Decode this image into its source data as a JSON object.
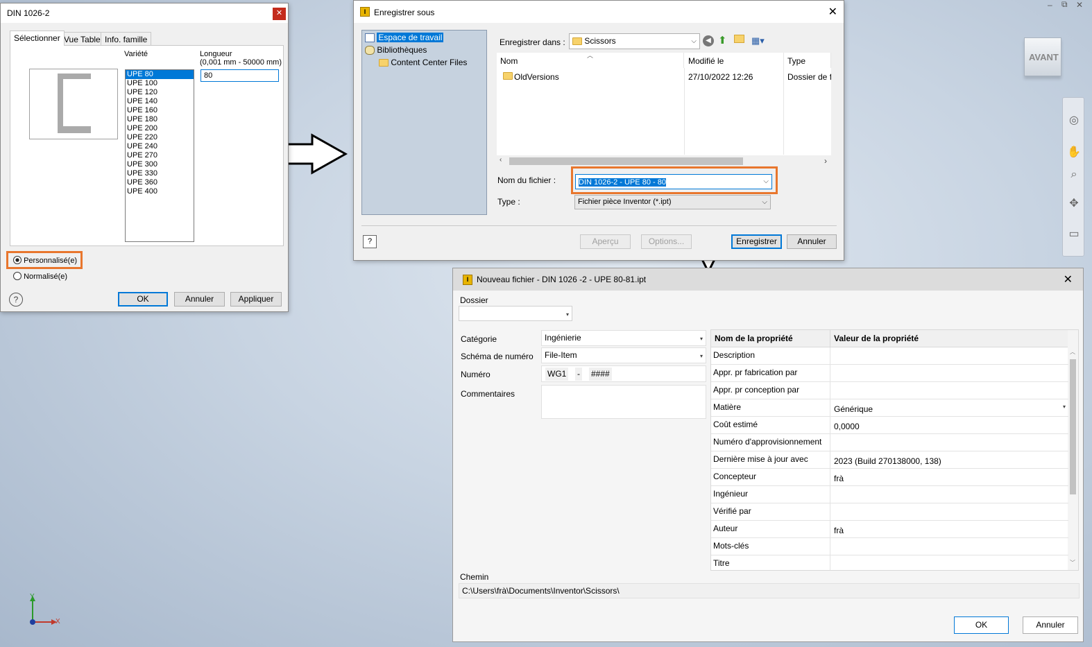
{
  "window_controls": {
    "restore": "⧉",
    "minimize": "–",
    "close": "✕"
  },
  "viewcube": {
    "label": "AVANT"
  },
  "axis": {
    "x": "X",
    "y": "Y"
  },
  "dialog1": {
    "title": "DIN 1026-2",
    "tabs": [
      "Sélectionner",
      "Vue Table",
      "Info. famille"
    ],
    "variety_label": "Variété",
    "length_label": "Longueur",
    "length_range": "(0,001 mm - 50000 mm)",
    "length_value": "80",
    "varieties": [
      "UPE 80",
      "UPE 100",
      "UPE 120",
      "UPE 140",
      "UPE 160",
      "UPE 180",
      "UPE 200",
      "UPE 220",
      "UPE 240",
      "UPE 270",
      "UPE 300",
      "UPE 330",
      "UPE 360",
      "UPE 400"
    ],
    "selected_variety": "UPE 80",
    "radio_custom": "Personnalisé(e)",
    "radio_standard": "Normalisé(e)",
    "ok": "OK",
    "cancel": "Annuler",
    "apply": "Appliquer"
  },
  "dialog2": {
    "title": "Enregistrer sous",
    "tree": [
      "Espace de travail",
      "Bibliothèques",
      "Content Center Files"
    ],
    "save_in_label": "Enregistrer dans :",
    "save_in_value": "Scissors",
    "columns": [
      "Nom",
      "Modifié le",
      "Type"
    ],
    "files": [
      {
        "name": "OldVersions",
        "modified": "27/10/2022 12:26",
        "type": "Dossier de fi"
      }
    ],
    "filename_label": "Nom du fichier :",
    "filename_value": "DIN 1026-2 - UPE 80 - 80",
    "type_label": "Type :",
    "type_value": "Fichier pièce Inventor (*.ipt)",
    "preview": "Aperçu",
    "options": "Options...",
    "save": "Enregistrer",
    "cancel": "Annuler"
  },
  "dialog3": {
    "title": "Nouveau fichier - DIN 1026 -2 - UPE 80-81.ipt",
    "folder_label": "Dossier",
    "category_label": "Catégorie",
    "category_value": "Ingénierie",
    "scheme_label": "Schéma de numéro",
    "scheme_value": "File-Item",
    "number_label": "Numéro",
    "number_prefix": "WG1",
    "number_sep": "-",
    "number_mask": "####",
    "comments_label": "Commentaires",
    "prop_name_header": "Nom de la propriété",
    "prop_value_header": "Valeur de la propriété",
    "properties": [
      {
        "name": "Description",
        "value": ""
      },
      {
        "name": "Appr. pr fabrication par",
        "value": ""
      },
      {
        "name": "Appr. pr conception par",
        "value": ""
      },
      {
        "name": "Matière",
        "value": "Générique"
      },
      {
        "name": "Coût estimé",
        "value": "0,0000"
      },
      {
        "name": "Numéro d'approvisionnement",
        "value": ""
      },
      {
        "name": "Dernière mise à jour avec",
        "value": "2023 (Build 270138000, 138)"
      },
      {
        "name": "Concepteur",
        "value": "frà"
      },
      {
        "name": "Ingénieur",
        "value": ""
      },
      {
        "name": "Vérifié par",
        "value": ""
      },
      {
        "name": "Auteur",
        "value": "frà"
      },
      {
        "name": "Mots-clés",
        "value": ""
      },
      {
        "name": "Titre",
        "value": ""
      }
    ],
    "path_label": "Chemin",
    "path_value": "C:\\Users\\frà\\Documents\\Inventor\\Scissors\\",
    "ok": "OK",
    "cancel": "Annuler"
  }
}
